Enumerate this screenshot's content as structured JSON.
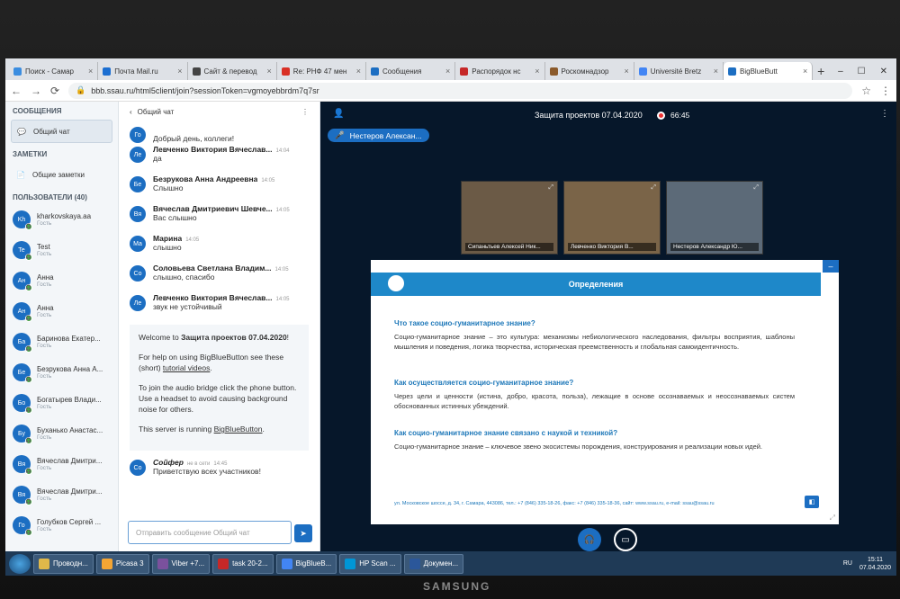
{
  "browser": {
    "tabs": [
      {
        "label": "Поиск - Самар",
        "color": "#3b8de0"
      },
      {
        "label": "Почта Mail.ru",
        "color": "#1b6ed1"
      },
      {
        "label": "Сайт & перевод",
        "color": "#444444"
      },
      {
        "label": "Re: РНФ 47 мен",
        "color": "#d93025"
      },
      {
        "label": "Сообщения",
        "color": "#1c6ec2"
      },
      {
        "label": "Распорядок нс",
        "color": "#c62828"
      },
      {
        "label": "Роскомнадзор",
        "color": "#8b5a2b"
      },
      {
        "label": "Université Bretz",
        "color": "#4285f4"
      },
      {
        "label": "BigBlueButt",
        "color": "#1c6ec2"
      }
    ],
    "url": "bbb.ssau.ru/html5client/join?sessionToken=vgmoyebbrdm7q7sr"
  },
  "sidebar": {
    "messages_title": "СООБЩЕНИЯ",
    "public_chat": "Общий чат",
    "notes_title": "ЗАМЕТКИ",
    "shared_notes": "Общие заметки",
    "users_title": "ПОЛЬЗОВАТЕЛИ (40)",
    "users": [
      {
        "initials": "Kh",
        "name": "kharkovskaya.aa",
        "role": "Гость"
      },
      {
        "initials": "Te",
        "name": "Test",
        "role": "Гость"
      },
      {
        "initials": "Ан",
        "name": "Анна",
        "role": "Гость"
      },
      {
        "initials": "Ан",
        "name": "Анна",
        "role": "Гость"
      },
      {
        "initials": "Ба",
        "name": "Баринова Екатер...",
        "role": "Гость"
      },
      {
        "initials": "Бе",
        "name": "Безрукова Анна А...",
        "role": "Гость"
      },
      {
        "initials": "Бо",
        "name": "Богатырев Влади...",
        "role": "Гость"
      },
      {
        "initials": "Бу",
        "name": "Буханько Анастас...",
        "role": "Гость"
      },
      {
        "initials": "Вя",
        "name": "Вячеслав Дмитри...",
        "role": "Гость"
      },
      {
        "initials": "Вя",
        "name": "Вячеслав Дмитри...",
        "role": "Гость"
      },
      {
        "initials": "Го",
        "name": "Голубков Сергей ...",
        "role": "Гость"
      }
    ]
  },
  "chat": {
    "header": "Общий чат",
    "messages": [
      {
        "initials": "Го",
        "name": "",
        "time": "",
        "text": "Добрый день, коллеги!"
      },
      {
        "initials": "Ле",
        "name": "Левченко Виктория Вячеслав...",
        "time": "14:04",
        "text": "да"
      },
      {
        "initials": "Бе",
        "name": "Безрукова Анна Андреевна",
        "time": "14:05",
        "text": "Слышно"
      },
      {
        "initials": "Вя",
        "name": "Вячеслав Дмитриевич Шевче...",
        "time": "14:05",
        "text": "Вас слышно"
      },
      {
        "initials": "Ма",
        "name": "Марина",
        "time": "14:05",
        "text": "слышно"
      },
      {
        "initials": "Со",
        "name": "Соловьева Светлана Владим...",
        "time": "14:05",
        "text": "слышно, спасибо"
      },
      {
        "initials": "Ле",
        "name": "Левченко Виктория Вячеслав...",
        "time": "14:05",
        "text": "звук не устойчивый"
      }
    ],
    "welcome": {
      "line1_prefix": "Welcome to ",
      "line1_bold": "Защита проектов 07.04.2020",
      "line1_suffix": "!",
      "line2_prefix": "For help on using BigBlueButton see these (short) ",
      "line2_link": "tutorial videos",
      "line2_suffix": ".",
      "line3": "To join the audio bridge click the phone button. Use a headset to avoid causing background noise for others.",
      "line4_prefix": "This server is running ",
      "line4_link": "BigBlueButton",
      "line4_suffix": "."
    },
    "last": {
      "initials": "Со",
      "name": "Сойфер",
      "status": "не в сети",
      "time": "14:45",
      "text": "Приветствую всех участников!"
    },
    "input_placeholder": "Отправить сообщение Общий чат"
  },
  "main": {
    "title": "Защита проектов",
    "date": "07.04.2020",
    "rec_time": "66:45",
    "talker": "Нестеров Алексан...",
    "videos": [
      {
        "caption": "Сипаньтьев Алексей Ник...",
        "color": "#6b5a46"
      },
      {
        "caption": "Левченко Виктория В...",
        "color": "#7a6448"
      },
      {
        "caption": "Нестеров Александр Ю...",
        "color": "#5c6a78"
      }
    ],
    "slide": {
      "banner": "Определения",
      "q1": "Что такое социо-гуманитарное знание?",
      "a1": "Социо-гуманитарное знание – это культура: механизмы небиологического наследования, фильтры восприятия, шаблоны мышления и поведения, логика творчества, историческая преемственность и глобальная самоидентичность.",
      "q2": "Как осуществляется социо-гуманитарное знание?",
      "a2": "Через цели и ценности (истина, добро, красота, польза), лежащие в основе осознаваемых и неосознаваемых систем обоснованных истинных убеждений.",
      "q3": "Как социо-гуманитарное знание связано с наукой и техникой?",
      "a3": "Социо-гуманитарное знание – ключевое звено экосистемы порождения, конструирования и реализации новых идей.",
      "footer": "ул. Московское шоссе, д. 34, г. Самара, 443086, тел.: +7 (846) 335-18-26, факс: +7 (846) 335-18-36, сайт: www.ssau.ru, e-mail: ssau@ssau.ru"
    }
  },
  "taskbar": {
    "items": [
      {
        "label": "Проводн...",
        "color": "#e0b84a"
      },
      {
        "label": "Picasa 3",
        "color": "#f4a534"
      },
      {
        "label": "Viber +7...",
        "color": "#7b519d"
      },
      {
        "label": "task 20-2...",
        "color": "#c62828"
      },
      {
        "label": "BigBlueB...",
        "color": "#4285f4"
      },
      {
        "label": "HP Scan ...",
        "color": "#0096d6"
      },
      {
        "label": "Докумен...",
        "color": "#2b579a"
      }
    ],
    "lang": "RU",
    "time": "15:11",
    "date": "07.04.2020"
  },
  "brand": "SAMSUNG"
}
